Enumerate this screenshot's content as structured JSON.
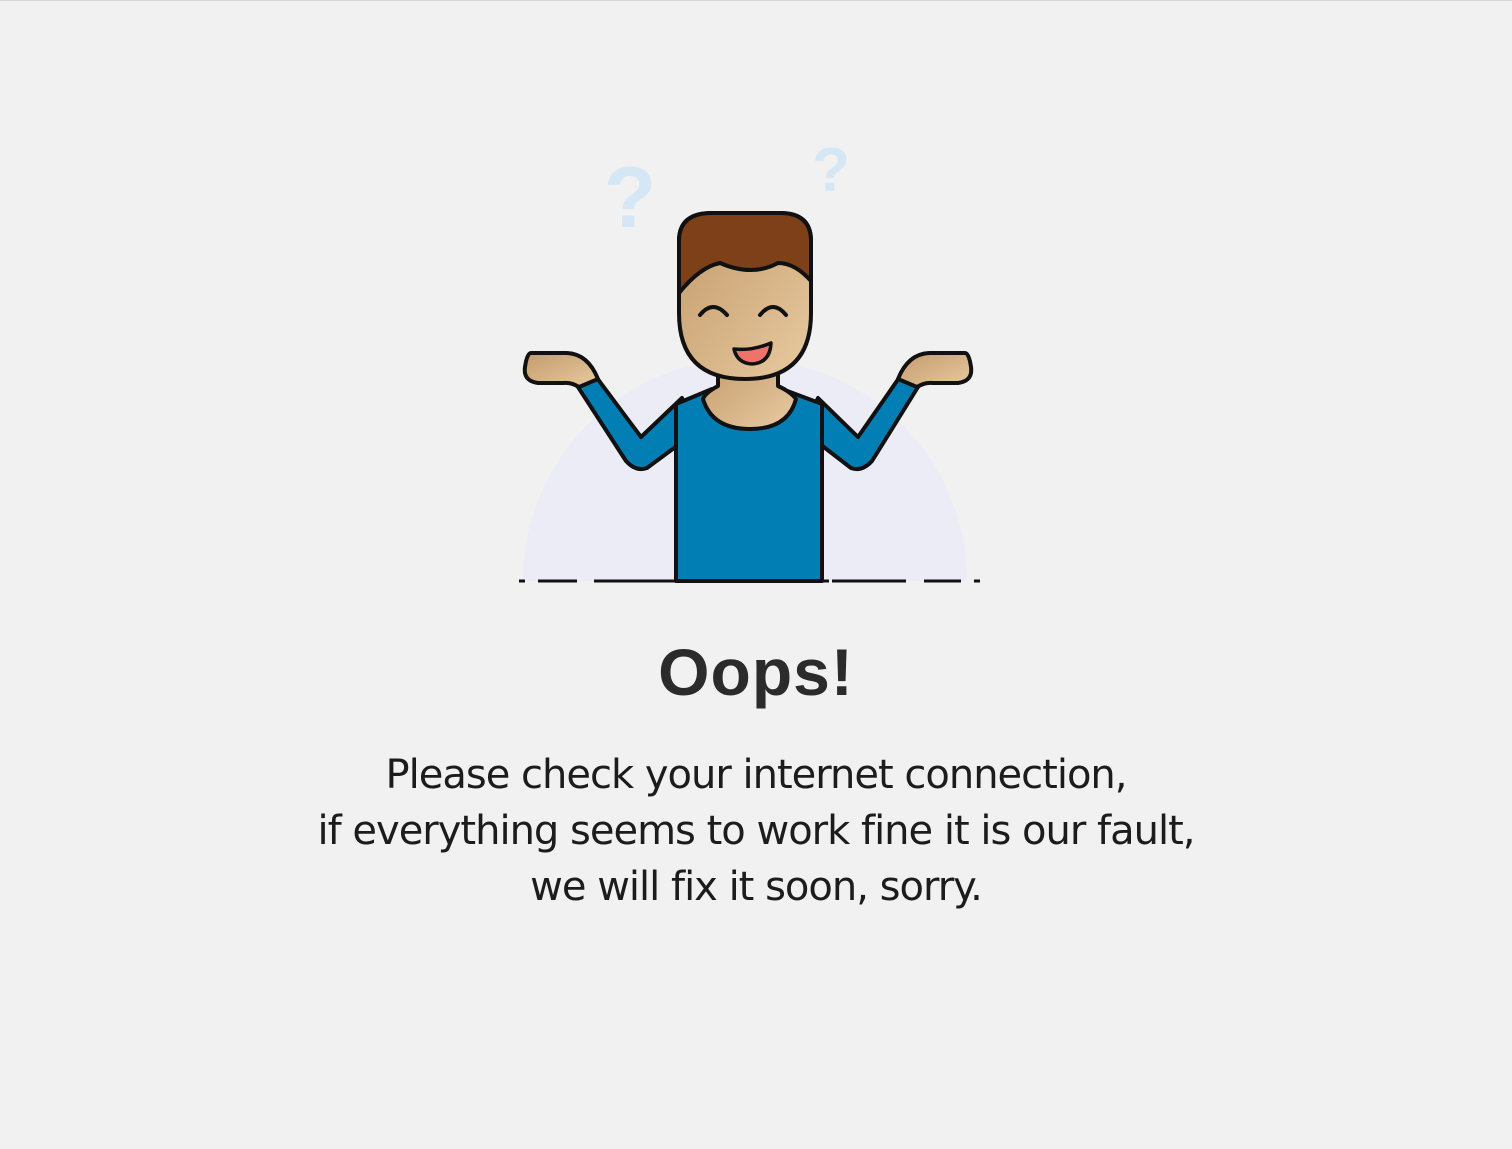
{
  "error": {
    "title": "Oops!",
    "message_lines": [
      "Please check your internet connection,",
      "if everything seems to work fine it is our fault,",
      "we will fix it soon, sorry."
    ]
  },
  "illustration": {
    "question_mark": "?",
    "colors": {
      "background": "#f1f1f1",
      "backdrop": "#ececf6",
      "shirt": "#017fb5",
      "hair": "#7d4019",
      "skin": "#d7b58c",
      "mouth": "#f0726a",
      "question_marks": "#d5e7f4",
      "outline": "#111111"
    }
  }
}
